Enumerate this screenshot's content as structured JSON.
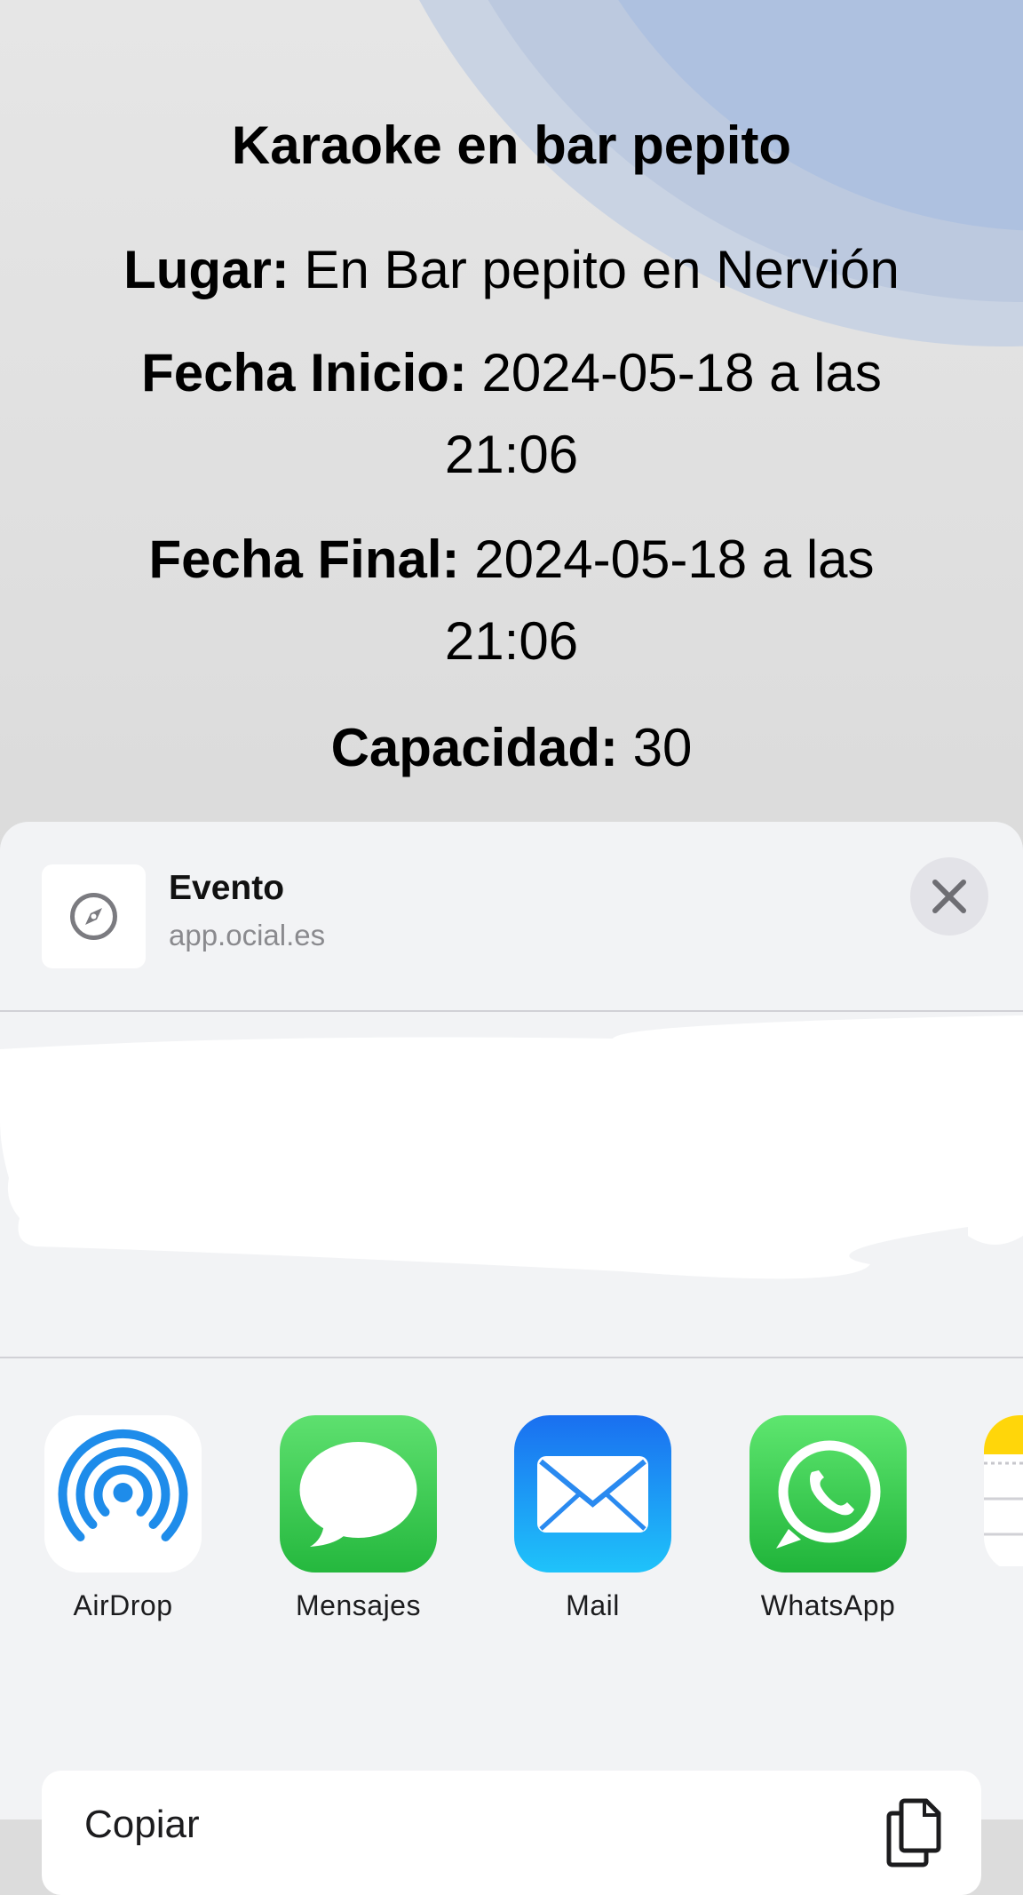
{
  "event": {
    "title": "Karaoke en bar pepito",
    "lugar_label": "Lugar:",
    "lugar_value": "En Bar pepito en Nervión",
    "inicio_label": "Fecha Inicio:",
    "inicio_value_line1": "2024-05-18 a las",
    "inicio_value_line2": "21:06",
    "final_label": "Fecha Final:",
    "final_value_line1": "2024-05-18 a las",
    "final_value_line2": "21:06",
    "capacidad_label": "Capacidad:",
    "capacidad_value": "30"
  },
  "share_sheet": {
    "title": "Evento",
    "url": "app.ocial.es",
    "favicon_icon": "compass-icon",
    "close_icon": "close-icon",
    "apps": [
      {
        "label": "AirDrop",
        "icon": "airdrop-icon"
      },
      {
        "label": "Mensajes",
        "icon": "messages-icon"
      },
      {
        "label": "Mail",
        "icon": "mail-icon"
      },
      {
        "label": "WhatsApp",
        "icon": "whatsapp-icon"
      },
      {
        "label": "",
        "icon": "notes-icon"
      }
    ],
    "copy_label": "Copiar",
    "copy_icon": "copy-icon"
  },
  "colors": {
    "messages_green": "#34c759",
    "mail_blue": "#1a8cf0",
    "whatsapp_green": "#2ecc4f",
    "airdrop_blue": "#1e8cea",
    "notes_yellow": "#ffd60a"
  }
}
